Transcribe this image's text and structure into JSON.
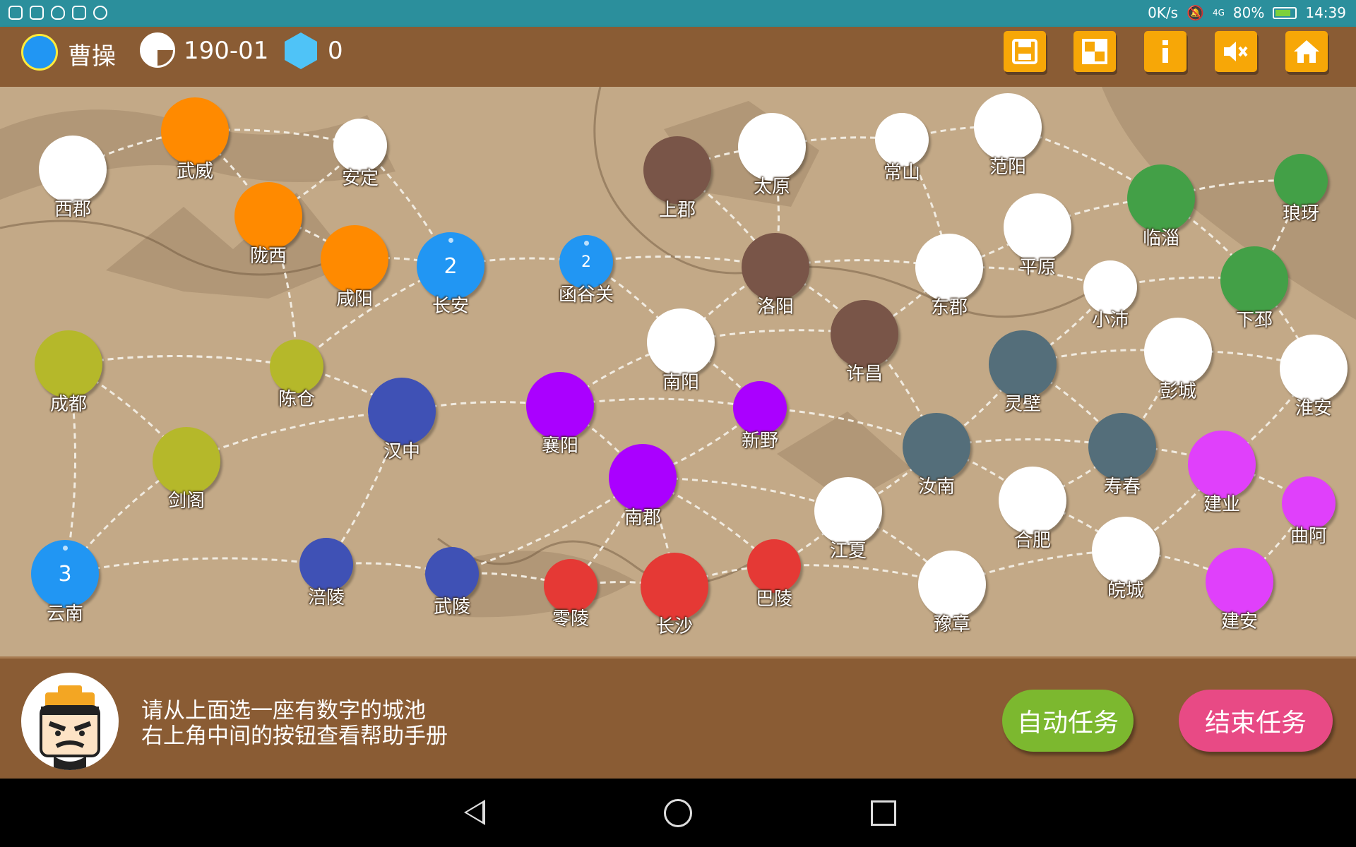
{
  "status_bar": {
    "speed": "0K/s",
    "network": "4G",
    "battery": "80%",
    "battery_level": 0.8,
    "time": "14:39"
  },
  "player": {
    "name": "曹操",
    "color": "#2196f3",
    "date": "190-01",
    "gems": "0"
  },
  "toolbar": {
    "buttons": [
      {
        "name": "save",
        "icon": "save-icon"
      },
      {
        "name": "layout",
        "icon": "grid-icon"
      },
      {
        "name": "info",
        "icon": "info-icon"
      },
      {
        "name": "mute",
        "icon": "mute-icon"
      },
      {
        "name": "home",
        "icon": "home-icon"
      }
    ]
  },
  "factions": {
    "cao": "#2196f3",
    "orange": "#ff8a00",
    "olive": "#b5b82a",
    "navy": "#3f51b5",
    "brown": "#795548",
    "purple": "#aa00ff",
    "red": "#e53935",
    "slate": "#546e7a",
    "green": "#43a047",
    "pink": "#e040fb",
    "neutral": "#ffffff"
  },
  "cities": [
    {
      "id": "xijun",
      "name": "西郡",
      "faction": "neutral"
    },
    {
      "id": "wuwei",
      "name": "武威",
      "faction": "orange"
    },
    {
      "id": "anding",
      "name": "安定",
      "faction": "neutral"
    },
    {
      "id": "longxi",
      "name": "陇西",
      "faction": "orange"
    },
    {
      "id": "xianyang",
      "name": "咸阳",
      "faction": "orange"
    },
    {
      "id": "changan",
      "name": "长安",
      "faction": "cao",
      "troops": "2"
    },
    {
      "id": "hanguguan",
      "name": "函谷关",
      "faction": "cao",
      "troops": "2"
    },
    {
      "id": "shangjun",
      "name": "上郡",
      "faction": "brown"
    },
    {
      "id": "taiyuan",
      "name": "太原",
      "faction": "neutral"
    },
    {
      "id": "changshan",
      "name": "常山",
      "faction": "neutral"
    },
    {
      "id": "fanyang",
      "name": "范阳",
      "faction": "neutral"
    },
    {
      "id": "pingyuan",
      "name": "平原",
      "faction": "neutral"
    },
    {
      "id": "linzi",
      "name": "临淄",
      "faction": "green"
    },
    {
      "id": "langya",
      "name": "琅玡",
      "faction": "green"
    },
    {
      "id": "luoyang",
      "name": "洛阳",
      "faction": "brown"
    },
    {
      "id": "dongjun",
      "name": "东郡",
      "faction": "neutral"
    },
    {
      "id": "xiaopei",
      "name": "小沛",
      "faction": "neutral"
    },
    {
      "id": "xiapi",
      "name": "下邳",
      "faction": "green"
    },
    {
      "id": "chengdu",
      "name": "成都",
      "faction": "olive"
    },
    {
      "id": "chencang",
      "name": "陈仓",
      "faction": "olive"
    },
    {
      "id": "hanzhong",
      "name": "汉中",
      "faction": "navy"
    },
    {
      "id": "xiangyang",
      "name": "襄阳",
      "faction": "purple"
    },
    {
      "id": "nanyang",
      "name": "南阳",
      "faction": "neutral"
    },
    {
      "id": "xinye",
      "name": "新野",
      "faction": "purple"
    },
    {
      "id": "xuchang",
      "name": "许昌",
      "faction": "brown"
    },
    {
      "id": "lingbi",
      "name": "灵壁",
      "faction": "slate"
    },
    {
      "id": "pengcheng",
      "name": "彭城",
      "faction": "neutral"
    },
    {
      "id": "huaian",
      "name": "淮安",
      "faction": "neutral"
    },
    {
      "id": "jiange",
      "name": "剑阁",
      "faction": "olive"
    },
    {
      "id": "nanjun",
      "name": "南郡",
      "faction": "purple"
    },
    {
      "id": "runan",
      "name": "汝南",
      "faction": "slate"
    },
    {
      "id": "shouchun",
      "name": "寿春",
      "faction": "slate"
    },
    {
      "id": "jianye",
      "name": "建业",
      "faction": "pink"
    },
    {
      "id": "qua",
      "name": "曲阿",
      "faction": "pink"
    },
    {
      "id": "jiangxia",
      "name": "江夏",
      "faction": "neutral"
    },
    {
      "id": "hefei",
      "name": "合肥",
      "faction": "neutral"
    },
    {
      "id": "yunnan",
      "name": "云南",
      "faction": "cao",
      "troops": "3"
    },
    {
      "id": "fuling",
      "name": "涪陵",
      "faction": "navy"
    },
    {
      "id": "wuling",
      "name": "武陵",
      "faction": "navy"
    },
    {
      "id": "lingling",
      "name": "零陵",
      "faction": "red"
    },
    {
      "id": "changsha",
      "name": "长沙",
      "faction": "red"
    },
    {
      "id": "baling",
      "name": "巴陵",
      "faction": "red"
    },
    {
      "id": "yuzhang",
      "name": "豫章",
      "faction": "neutral"
    },
    {
      "id": "wancheng",
      "name": "皖城",
      "faction": "neutral"
    },
    {
      "id": "jianan",
      "name": "建安",
      "faction": "pink"
    }
  ],
  "message": {
    "line1": "请从上面选一座有数字的城池",
    "line2": "右上角中间的按钮查看帮助手册"
  },
  "actions": {
    "auto_label": "自动任务",
    "auto_color": "#7cb82f",
    "end_label": "结束任务",
    "end_color": "#e84a85"
  }
}
